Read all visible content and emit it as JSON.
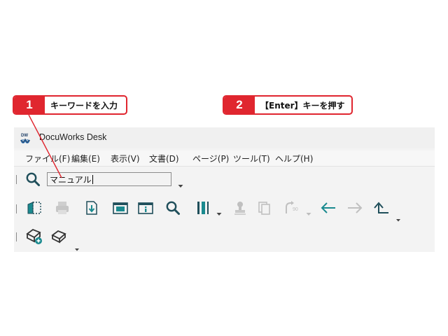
{
  "callouts": [
    {
      "num": "1",
      "text": "キーワードを入力"
    },
    {
      "num": "2",
      "text": "【Enter】キーを押す"
    }
  ],
  "window": {
    "app_icon_text": "DW",
    "title": "DocuWorks Desk"
  },
  "menu": [
    "ファイル(F)",
    "編集(E)",
    "表示(V)",
    "文書(D)",
    "ページ(P)",
    "ツール(T)",
    "ヘルプ(H)"
  ],
  "search": {
    "value": "マニュアル"
  },
  "colors": {
    "accent_red": "#e0262f",
    "teal": "#1a8a8f",
    "icon_dark": "#1f4e5a",
    "disabled": "#b8b8b8"
  }
}
